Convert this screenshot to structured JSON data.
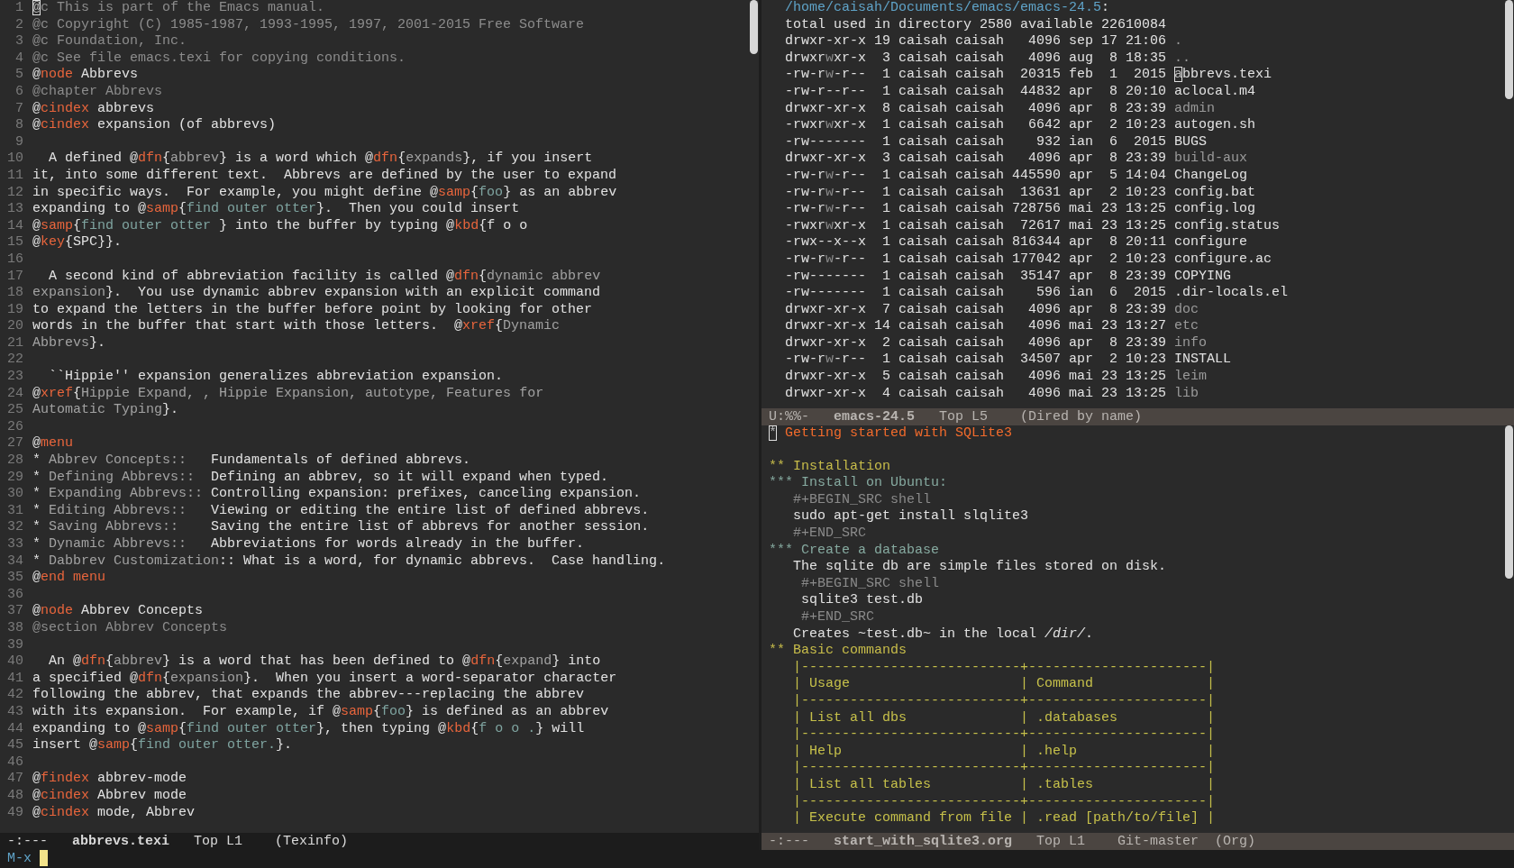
{
  "left_window": {
    "lines": [
      {
        "number": "1",
        "segments": [
          {
            "kind": "cursor",
            "text": "@"
          },
          {
            "kind": "comment",
            "text": "c This is part of the Emacs manual."
          }
        ]
      },
      {
        "number": "2",
        "segments": [
          {
            "kind": "comment",
            "text": "@c Copyright (C) 1985-1987, 1993-1995, 1997, 2001-2015 Free Software"
          }
        ]
      },
      {
        "number": "3",
        "segments": [
          {
            "kind": "comment",
            "text": "@c Foundation, Inc."
          }
        ]
      },
      {
        "number": "4",
        "segments": [
          {
            "kind": "comment",
            "text": "@c See file emacs.texi for copying conditions."
          }
        ]
      },
      {
        "number": "5",
        "segments": [
          {
            "kind": "plain",
            "text": "@"
          },
          {
            "kind": "keyword",
            "text": "node"
          },
          {
            "kind": "plain",
            "text": " Abbrevs"
          }
        ]
      },
      {
        "number": "6",
        "segments": [
          {
            "kind": "comment",
            "text": "@chapter Abbrevs"
          }
        ]
      },
      {
        "number": "7",
        "segments": [
          {
            "kind": "plain",
            "text": "@"
          },
          {
            "kind": "keyword",
            "text": "cindex"
          },
          {
            "kind": "plain",
            "text": " abbrevs"
          }
        ]
      },
      {
        "number": "8",
        "segments": [
          {
            "kind": "plain",
            "text": "@"
          },
          {
            "kind": "keyword",
            "text": "cindex"
          },
          {
            "kind": "plain",
            "text": " expansion (of abbrevs)"
          }
        ]
      },
      {
        "number": "9"
      },
      {
        "number": "10",
        "segments": [
          {
            "kind": "plain",
            "text": "  A defined @"
          },
          {
            "kind": "keyword",
            "text": "dfn"
          },
          {
            "kind": "plain",
            "text": "{"
          },
          {
            "kind": "arg",
            "text": "abbrev"
          },
          {
            "kind": "plain",
            "text": "} is a word which @"
          },
          {
            "kind": "keyword",
            "text": "dfn"
          },
          {
            "kind": "plain",
            "text": "{"
          },
          {
            "kind": "arg",
            "text": "expands"
          },
          {
            "kind": "plain",
            "text": "}, if you insert"
          }
        ]
      },
      {
        "number": "11",
        "segments": [
          {
            "kind": "plain",
            "text": "it, into some different text.  Abbrevs are defined by the user to expand"
          }
        ]
      },
      {
        "number": "12",
        "segments": [
          {
            "kind": "plain",
            "text": "in specific ways.  For example, you might define @"
          },
          {
            "kind": "keyword",
            "text": "samp"
          },
          {
            "kind": "plain",
            "text": "{"
          },
          {
            "kind": "code",
            "text": "foo"
          },
          {
            "kind": "plain",
            "text": "} as an abbrev"
          }
        ]
      },
      {
        "number": "13",
        "segments": [
          {
            "kind": "plain",
            "text": "expanding to @"
          },
          {
            "kind": "keyword",
            "text": "samp"
          },
          {
            "kind": "plain",
            "text": "{"
          },
          {
            "kind": "code",
            "text": "find outer otter"
          },
          {
            "kind": "plain",
            "text": "}.  Then you could insert"
          }
        ]
      },
      {
        "number": "14",
        "segments": [
          {
            "kind": "plain",
            "text": "@"
          },
          {
            "kind": "keyword",
            "text": "samp"
          },
          {
            "kind": "plain",
            "text": "{"
          },
          {
            "kind": "code",
            "text": "find outer otter "
          },
          {
            "kind": "plain",
            "text": "} into the buffer by typing @"
          },
          {
            "kind": "keyword",
            "text": "kbd"
          },
          {
            "kind": "plain",
            "text": "{f o o"
          }
        ]
      },
      {
        "number": "15",
        "segments": [
          {
            "kind": "plain",
            "text": "@"
          },
          {
            "kind": "keyword",
            "text": "key"
          },
          {
            "kind": "plain",
            "text": "{SPC}}."
          }
        ]
      },
      {
        "number": "16"
      },
      {
        "number": "17",
        "segments": [
          {
            "kind": "plain",
            "text": "  A second kind of abbreviation facility is called @"
          },
          {
            "kind": "keyword",
            "text": "dfn"
          },
          {
            "kind": "plain",
            "text": "{"
          },
          {
            "kind": "arg",
            "text": "dynamic abbrev"
          }
        ]
      },
      {
        "number": "18",
        "segments": [
          {
            "kind": "arg",
            "text": "expansion"
          },
          {
            "kind": "plain",
            "text": "}.  You use dynamic abbrev expansion with an explicit command"
          }
        ]
      },
      {
        "number": "19",
        "segments": [
          {
            "kind": "plain",
            "text": "to expand the letters in the buffer before point by looking for other"
          }
        ]
      },
      {
        "number": "20",
        "segments": [
          {
            "kind": "plain",
            "text": "words in the buffer that start with those letters.  @"
          },
          {
            "kind": "keyword",
            "text": "xref"
          },
          {
            "kind": "plain",
            "text": "{"
          },
          {
            "kind": "arg",
            "text": "Dynamic"
          }
        ]
      },
      {
        "number": "21",
        "segments": [
          {
            "kind": "arg",
            "text": "Abbrevs"
          },
          {
            "kind": "plain",
            "text": "}."
          }
        ]
      },
      {
        "number": "22"
      },
      {
        "number": "23",
        "segments": [
          {
            "kind": "plain",
            "text": "  ``Hippie'' expansion generalizes abbreviation expansion."
          }
        ]
      },
      {
        "number": "24",
        "segments": [
          {
            "kind": "plain",
            "text": "@"
          },
          {
            "kind": "keyword",
            "text": "xref"
          },
          {
            "kind": "plain",
            "text": "{"
          },
          {
            "kind": "arg",
            "text": "Hippie Expand, , Hippie Expansion, autotype, Features for"
          }
        ]
      },
      {
        "number": "25",
        "segments": [
          {
            "kind": "arg",
            "text": "Automatic Typing"
          },
          {
            "kind": "plain",
            "text": "}."
          }
        ]
      },
      {
        "number": "26"
      },
      {
        "number": "27",
        "segments": [
          {
            "kind": "plain",
            "text": "@"
          },
          {
            "kind": "keyword",
            "text": "menu"
          }
        ]
      },
      {
        "number": "28",
        "segments": [
          {
            "kind": "plain",
            "text": "* "
          },
          {
            "kind": "arg",
            "text": "Abbrev Concepts::"
          },
          {
            "kind": "plain",
            "text": "   Fundamentals of defined abbrevs."
          }
        ]
      },
      {
        "number": "29",
        "segments": [
          {
            "kind": "plain",
            "text": "* "
          },
          {
            "kind": "arg",
            "text": "Defining Abbrevs::"
          },
          {
            "kind": "plain",
            "text": "  Defining an abbrev, so it will expand when typed."
          }
        ]
      },
      {
        "number": "30",
        "segments": [
          {
            "kind": "plain",
            "text": "* "
          },
          {
            "kind": "arg",
            "text": "Expanding Abbrevs::"
          },
          {
            "kind": "plain",
            "text": " Controlling expansion: prefixes, canceling expansion."
          }
        ]
      },
      {
        "number": "31",
        "segments": [
          {
            "kind": "plain",
            "text": "* "
          },
          {
            "kind": "arg",
            "text": "Editing Abbrevs::"
          },
          {
            "kind": "plain",
            "text": "   Viewing or editing the entire list of defined abbrevs."
          }
        ]
      },
      {
        "number": "32",
        "segments": [
          {
            "kind": "plain",
            "text": "* "
          },
          {
            "kind": "arg",
            "text": "Saving Abbrevs::"
          },
          {
            "kind": "plain",
            "text": "    Saving the entire list of abbrevs for another session."
          }
        ]
      },
      {
        "number": "33",
        "segments": [
          {
            "kind": "plain",
            "text": "* "
          },
          {
            "kind": "arg",
            "text": "Dynamic Abbrevs::"
          },
          {
            "kind": "plain",
            "text": "   Abbreviations for words already in the buffer."
          }
        ]
      },
      {
        "number": "34",
        "segments": [
          {
            "kind": "plain",
            "text": "* "
          },
          {
            "kind": "arg",
            "text": "Dabbrev Customization"
          },
          {
            "kind": "plain",
            "text": ":: What is a word, for dynamic abbrevs.  Case handling."
          }
        ]
      },
      {
        "number": "35",
        "segments": [
          {
            "kind": "plain",
            "text": "@"
          },
          {
            "kind": "keyword",
            "text": "end menu"
          }
        ]
      },
      {
        "number": "36"
      },
      {
        "number": "37",
        "segments": [
          {
            "kind": "plain",
            "text": "@"
          },
          {
            "kind": "keyword",
            "text": "node"
          },
          {
            "kind": "plain",
            "text": " Abbrev Concepts"
          }
        ]
      },
      {
        "number": "38",
        "segments": [
          {
            "kind": "comment",
            "text": "@section Abbrev Concepts"
          }
        ]
      },
      {
        "number": "39"
      },
      {
        "number": "40",
        "segments": [
          {
            "kind": "plain",
            "text": "  An @"
          },
          {
            "kind": "keyword",
            "text": "dfn"
          },
          {
            "kind": "plain",
            "text": "{"
          },
          {
            "kind": "arg",
            "text": "abbrev"
          },
          {
            "kind": "plain",
            "text": "} is a word that has been defined to @"
          },
          {
            "kind": "keyword",
            "text": "dfn"
          },
          {
            "kind": "plain",
            "text": "{"
          },
          {
            "kind": "arg",
            "text": "expand"
          },
          {
            "kind": "plain",
            "text": "} into"
          }
        ]
      },
      {
        "number": "41",
        "segments": [
          {
            "kind": "plain",
            "text": "a specified @"
          },
          {
            "kind": "keyword",
            "text": "dfn"
          },
          {
            "kind": "plain",
            "text": "{"
          },
          {
            "kind": "arg",
            "text": "expansion"
          },
          {
            "kind": "plain",
            "text": "}.  When you insert a word-separator character"
          }
        ]
      },
      {
        "number": "42",
        "segments": [
          {
            "kind": "plain",
            "text": "following the abbrev, that expands the abbrev---replacing the abbrev"
          }
        ]
      },
      {
        "number": "43",
        "segments": [
          {
            "kind": "plain",
            "text": "with its expansion.  For example, if @"
          },
          {
            "kind": "keyword",
            "text": "samp"
          },
          {
            "kind": "plain",
            "text": "{"
          },
          {
            "kind": "code",
            "text": "foo"
          },
          {
            "kind": "plain",
            "text": "} is defined as an abbrev"
          }
        ]
      },
      {
        "number": "44",
        "segments": [
          {
            "kind": "plain",
            "text": "expanding to @"
          },
          {
            "kind": "keyword",
            "text": "samp"
          },
          {
            "kind": "plain",
            "text": "{"
          },
          {
            "kind": "code",
            "text": "find outer otter"
          },
          {
            "kind": "plain",
            "text": "}, then typing @"
          },
          {
            "kind": "keyword",
            "text": "kbd"
          },
          {
            "kind": "plain",
            "text": "{"
          },
          {
            "kind": "code",
            "text": "f o o ."
          },
          {
            "kind": "plain",
            "text": "} will"
          }
        ]
      },
      {
        "number": "45",
        "segments": [
          {
            "kind": "plain",
            "text": "insert @"
          },
          {
            "kind": "keyword",
            "text": "samp"
          },
          {
            "kind": "plain",
            "text": "{"
          },
          {
            "kind": "code",
            "text": "find outer otter."
          },
          {
            "kind": "plain",
            "text": "}."
          }
        ]
      },
      {
        "number": "46"
      },
      {
        "number": "47",
        "segments": [
          {
            "kind": "plain",
            "text": "@"
          },
          {
            "kind": "keyword",
            "text": "findex"
          },
          {
            "kind": "plain",
            "text": " abbrev-mode"
          }
        ]
      },
      {
        "number": "48",
        "segments": [
          {
            "kind": "plain",
            "text": "@"
          },
          {
            "kind": "keyword",
            "text": "cindex"
          },
          {
            "kind": "plain",
            "text": " Abbrev mode"
          }
        ]
      },
      {
        "number": "49",
        "segments": [
          {
            "kind": "plain",
            "text": "@"
          },
          {
            "kind": "keyword",
            "text": "cindex"
          },
          {
            "kind": "plain",
            "text": " mode, Abbrev"
          }
        ]
      }
    ],
    "mode_line": {
      "active": true,
      "status": "-:---",
      "buffer": "abbrevs.texi",
      "position": "Top L1",
      "mode": "(Texinfo)"
    }
  },
  "right_windows": [
    {
      "lines": [
        {
          "segments": [
            {
              "kind": "path",
              "text": "  /home/caisah/Documents/emacs/emacs-24.5"
            },
            {
              "kind": "plain",
              "text": ":"
            }
          ]
        },
        {
          "segments": [
            {
              "kind": "plain",
              "text": "  total used in directory 2580 available 22610084"
            }
          ]
        },
        {
          "segments": [
            {
              "kind": "plain",
              "text": "  drwxr-xr-x 19 caisah caisah   4096 sep 17 21:06 "
            },
            {
              "kind": "dir",
              "text": "."
            }
          ]
        },
        {
          "segments": [
            {
              "kind": "plain",
              "text": "  drwxr"
            },
            {
              "kind": "dim",
              "text": "w"
            },
            {
              "kind": "plain",
              "text": "xr-x  3 caisah caisah   4096 aug  8 18:35 "
            },
            {
              "kind": "dir",
              "text": ".."
            }
          ]
        },
        {
          "segments": [
            {
              "kind": "plain",
              "text": "  -rw-r"
            },
            {
              "kind": "dim",
              "text": "w"
            },
            {
              "kind": "plain",
              "text": "-r--  1 caisah caisah  20315 feb  1  2015 "
            },
            {
              "kind": "cursor",
              "text": "a"
            },
            {
              "kind": "plain",
              "text": "bbrevs.texi"
            }
          ]
        },
        {
          "segments": [
            {
              "kind": "plain",
              "text": "  -rw-r--r--  1 caisah caisah  44832 apr  8 20:10 aclocal.m4"
            }
          ]
        },
        {
          "segments": [
            {
              "kind": "plain",
              "text": "  drwxr-xr-x  8 caisah caisah   4096 apr  8 23:39 "
            },
            {
              "kind": "dir",
              "text": "admin"
            }
          ]
        },
        {
          "segments": [
            {
              "kind": "plain",
              "text": "  -rwxr"
            },
            {
              "kind": "dim",
              "text": "w"
            },
            {
              "kind": "plain",
              "text": "xr-x  1 caisah caisah   6642 apr  2 10:23 autogen.sh"
            }
          ]
        },
        {
          "segments": [
            {
              "kind": "plain",
              "text": "  -rw-------  1 caisah caisah    932 ian  6  2015 BUGS"
            }
          ]
        },
        {
          "segments": [
            {
              "kind": "plain",
              "text": "  drwxr-xr-x  3 caisah caisah   4096 apr  8 23:39 "
            },
            {
              "kind": "dir",
              "text": "build-aux"
            }
          ]
        },
        {
          "segments": [
            {
              "kind": "plain",
              "text": "  -rw-r"
            },
            {
              "kind": "dim",
              "text": "w"
            },
            {
              "kind": "plain",
              "text": "-r--  1 caisah caisah 445590 apr  5 14:04 ChangeLog"
            }
          ]
        },
        {
          "segments": [
            {
              "kind": "plain",
              "text": "  -rw-r"
            },
            {
              "kind": "dim",
              "text": "w"
            },
            {
              "kind": "plain",
              "text": "-r--  1 caisah caisah  13631 apr  2 10:23 config.bat"
            }
          ]
        },
        {
          "segments": [
            {
              "kind": "plain",
              "text": "  -rw-r"
            },
            {
              "kind": "dim",
              "text": "w"
            },
            {
              "kind": "plain",
              "text": "-r--  1 caisah caisah 728756 mai 23 13:25 config.log"
            }
          ]
        },
        {
          "segments": [
            {
              "kind": "plain",
              "text": "  -rwxr"
            },
            {
              "kind": "dim",
              "text": "w"
            },
            {
              "kind": "plain",
              "text": "xr-x  1 caisah caisah  72617 mai 23 13:25 config.status"
            }
          ]
        },
        {
          "segments": [
            {
              "kind": "plain",
              "text": "  -rwx--x--x  1 caisah caisah 816344 apr  8 20:11 configure"
            }
          ]
        },
        {
          "segments": [
            {
              "kind": "plain",
              "text": "  -rw-r"
            },
            {
              "kind": "dim",
              "text": "w"
            },
            {
              "kind": "plain",
              "text": "-r--  1 caisah caisah 177042 apr  2 10:23 configure.ac"
            }
          ]
        },
        {
          "segments": [
            {
              "kind": "plain",
              "text": "  -rw-------  1 caisah caisah  35147 apr  8 23:39 COPYING"
            }
          ]
        },
        {
          "segments": [
            {
              "kind": "plain",
              "text": "  -rw-------  1 caisah caisah    596 ian  6  2015 .dir-locals.el"
            }
          ]
        },
        {
          "segments": [
            {
              "kind": "plain",
              "text": "  drwxr-xr-x  7 caisah caisah   4096 apr  8 23:39 "
            },
            {
              "kind": "dir",
              "text": "doc"
            }
          ]
        },
        {
          "segments": [
            {
              "kind": "plain",
              "text": "  drwxr-xr-x 14 caisah caisah   4096 mai 23 13:27 "
            },
            {
              "kind": "dir",
              "text": "etc"
            }
          ]
        },
        {
          "segments": [
            {
              "kind": "plain",
              "text": "  drwxr-xr-x  2 caisah caisah   4096 apr  8 23:39 "
            },
            {
              "kind": "dir",
              "text": "info"
            }
          ]
        },
        {
          "segments": [
            {
              "kind": "plain",
              "text": "  -rw-r"
            },
            {
              "kind": "dim",
              "text": "w"
            },
            {
              "kind": "plain",
              "text": "-r--  1 caisah caisah  34507 apr  2 10:23 INSTALL"
            }
          ]
        },
        {
          "segments": [
            {
              "kind": "plain",
              "text": "  drwxr-xr-x  5 caisah caisah   4096 mai 23 13:25 "
            },
            {
              "kind": "dir",
              "text": "leim"
            }
          ]
        },
        {
          "segments": [
            {
              "kind": "plain",
              "text": "  drwxr-xr-x  4 caisah caisah   4096 mai 23 13:25 "
            },
            {
              "kind": "dir",
              "text": "lib"
            }
          ]
        }
      ],
      "mode_line": {
        "active": false,
        "status": "U:%%-",
        "buffer": "emacs-24.5",
        "position": "Top L5",
        "mode": "(Dired by name)"
      }
    },
    {
      "lines": [
        {
          "segments": [
            {
              "kind": "cursor",
              "text": "*"
            },
            {
              "kind": "title",
              "text": " Getting started with SQLite3"
            }
          ]
        },
        {
          "blank_before": true,
          "segments": [
            {
              "kind": "heading2",
              "text": "** Installation"
            }
          ]
        },
        {
          "segments": [
            {
              "kind": "heading3",
              "text": "*** Install on Ubuntu:"
            }
          ]
        },
        {
          "segments": [
            {
              "kind": "meta",
              "text": "   #+BEGIN_SRC shell"
            }
          ]
        },
        {
          "segments": [
            {
              "kind": "plain",
              "text": "   sudo apt-get install slqlite3"
            }
          ]
        },
        {
          "segments": [
            {
              "kind": "meta",
              "text": "   #+END_SRC"
            }
          ]
        },
        {
          "segments": [
            {
              "kind": "heading3",
              "text": "*** Create a database"
            }
          ]
        },
        {
          "segments": [
            {
              "kind": "plain",
              "text": "   The sqlite db are simple files stored on disk."
            }
          ]
        },
        {
          "segments": [
            {
              "kind": "meta",
              "text": "    #+BEGIN_SRC shell"
            }
          ]
        },
        {
          "segments": [
            {
              "kind": "plain",
              "text": "    sqlite3 test.db"
            }
          ]
        },
        {
          "segments": [
            {
              "kind": "meta",
              "text": "    #+END_SRC"
            }
          ]
        },
        {
          "segments": [
            {
              "kind": "plain",
              "text": "   Creates ~test.db~ in the local "
            },
            {
              "kind": "italic",
              "text": "/dir/"
            },
            {
              "kind": "plain",
              "text": "."
            }
          ]
        },
        {
          "segments": [
            {
              "kind": "heading2",
              "text": "** Basic commands"
            }
          ]
        },
        {
          "segments": [
            {
              "kind": "table",
              "text": "   |---------------------------+----------------------|"
            }
          ]
        },
        {
          "segments": [
            {
              "kind": "table",
              "text": "   | Usage                     | Command              |"
            }
          ]
        },
        {
          "segments": [
            {
              "kind": "table",
              "text": "   |---------------------------+----------------------|"
            }
          ]
        },
        {
          "segments": [
            {
              "kind": "table",
              "text": "   | List all dbs              | .databases           |"
            }
          ]
        },
        {
          "segments": [
            {
              "kind": "table",
              "text": "   |---------------------------+----------------------|"
            }
          ]
        },
        {
          "segments": [
            {
              "kind": "table",
              "text": "   | Help                      | .help                |"
            }
          ]
        },
        {
          "segments": [
            {
              "kind": "table",
              "text": "   |---------------------------+----------------------|"
            }
          ]
        },
        {
          "segments": [
            {
              "kind": "table",
              "text": "   | List all tables           | .tables              |"
            }
          ]
        },
        {
          "segments": [
            {
              "kind": "table",
              "text": "   |---------------------------+----------------------|"
            }
          ]
        },
        {
          "segments": [
            {
              "kind": "table",
              "text": "   | Execute command from file | .read [path/to/file] |"
            }
          ]
        }
      ],
      "mode_line": {
        "active": false,
        "status": "-:---",
        "buffer": "start_with_sqlite3.org",
        "position": "Top L1",
        "vc": "Git-master",
        "mode": "(Org)"
      }
    }
  ],
  "minibuffer": {
    "prompt": "M-x"
  }
}
